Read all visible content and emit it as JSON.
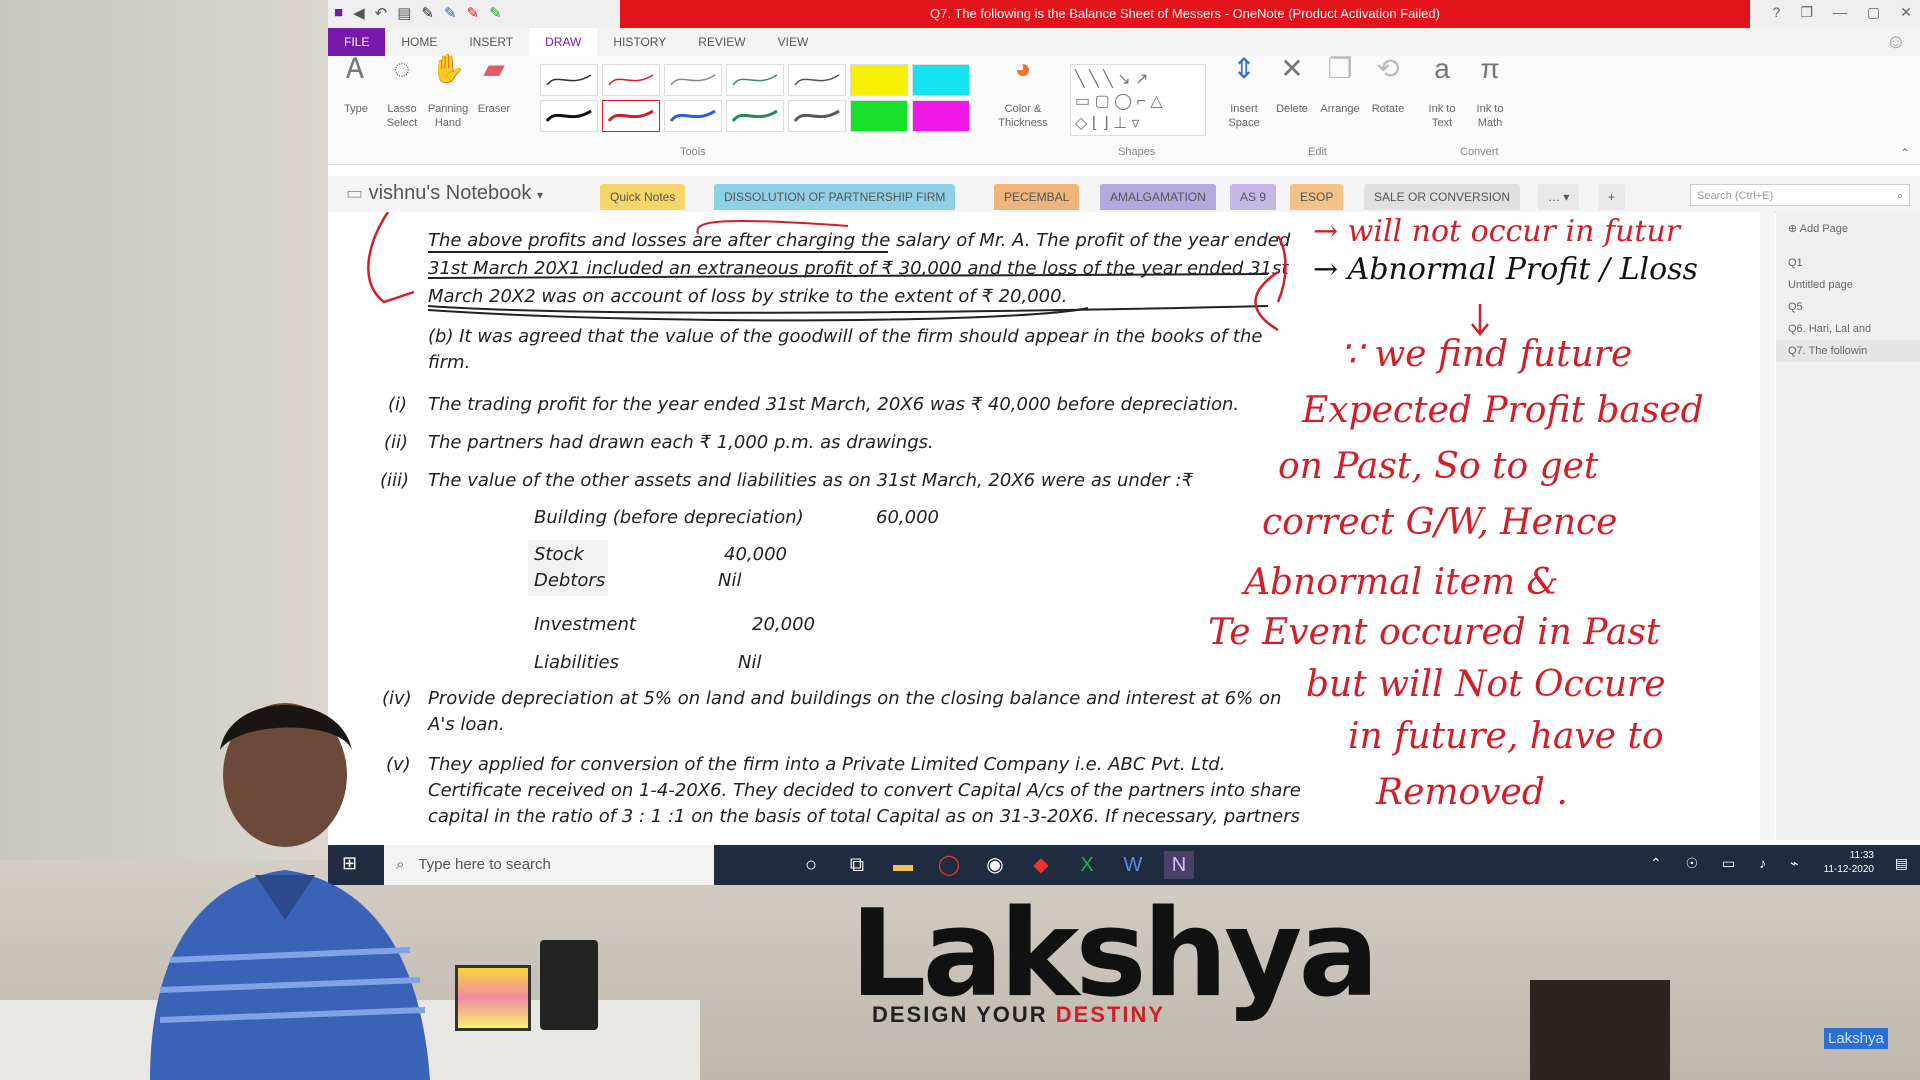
{
  "window": {
    "title": "Q7. The following is the Balance Sheet of Messers - OneNote (Product Activation Failed)",
    "title_color": "#e3131b"
  },
  "ribbon_tabs": [
    "FILE",
    "HOME",
    "INSERT",
    "DRAW",
    "HISTORY",
    "REVIEW",
    "VIEW"
  ],
  "ribbon": {
    "tools": [
      {
        "label": "Type",
        "icon": "type-icon"
      },
      {
        "label": "Lasso Select",
        "icon": "lasso-icon"
      },
      {
        "label": "Panning Hand",
        "icon": "hand-icon"
      },
      {
        "label": "Eraser",
        "icon": "eraser-icon"
      }
    ],
    "tools_group": "Tools",
    "color_thickness": "Color & Thickness",
    "shapes_group": "Shapes",
    "edit_tools": [
      {
        "label": "Insert Space",
        "icon": "insert-space-icon"
      },
      {
        "label": "Delete",
        "icon": "delete-icon"
      },
      {
        "label": "Arrange",
        "icon": "arrange-icon"
      },
      {
        "label": "Rotate",
        "icon": "rotate-icon"
      }
    ],
    "edit_group": "Edit",
    "convert_tools": [
      {
        "label": "Ink to Text",
        "icon": "ink-to-text-icon"
      },
      {
        "label": "Ink to Math",
        "icon": "ink-to-math-icon"
      }
    ],
    "convert_group": "Convert"
  },
  "notebook": {
    "name": "vishnu's Notebook",
    "sections": [
      {
        "label": "Quick Notes",
        "color": "#f6d66b"
      },
      {
        "label": "DISSOLUTION OF PARTNERSHIP FIRM",
        "color": "#8fd0e6"
      },
      {
        "label": "PECEMBAL",
        "color": "#f0b57a"
      },
      {
        "label": "AMALGAMATION",
        "color": "#b4a8de"
      },
      {
        "label": "AS 9",
        "color": "#c6b8e6"
      },
      {
        "label": "ESOP",
        "color": "#f3c18a"
      },
      {
        "label": "SALE OR CONVERSION",
        "color": "#e0e0e0"
      }
    ],
    "search_placeholder": "Search (Ctrl+E)"
  },
  "page_content": {
    "para1_line1": "The above profits and losses are after charging the salary of Mr. A. The profit of the year ended",
    "para1_line2": "31st March 20X1 included an extraneous profit of ₹ 30,000 and the loss of the year ended 31st",
    "para1_line3": "March 20X2 was on account of loss by strike to the extent of ₹ 20,000.",
    "b_line1": "(b)   It was agreed that the value of the goodwill of the firm should appear in   the books of the",
    "b_line2": "firm.",
    "i_num": "(i)",
    "i_text": "The trading profit for the year ended 31st March, 20X6 was ₹ 40,000 before depreciation.",
    "ii_num": "(ii)",
    "ii_text": "The partners had drawn each ₹ 1,000 p.m. as drawings.",
    "iii_num": "(iii)",
    "iii_text": "The value of the other assets and liabilities as on 31st March, 20X6 were as  under :₹",
    "assets": [
      {
        "name": "Building (before depreciation)",
        "value": "60,000"
      },
      {
        "name": "Stock",
        "value": "40,000"
      },
      {
        "name": "Debtors",
        "value": "Nil"
      },
      {
        "name": "Investment",
        "value": "20,000"
      },
      {
        "name": "Liabilities",
        "value": "Nil"
      }
    ],
    "iv_num": "(iv)",
    "iv_line1": "Provide depreciation at 5% on land and buildings on the closing balance and interest at 6% on",
    "iv_line2": "A's loan.",
    "v_num": "(v)",
    "v_line1": "They applied for conversion of the firm into a Private Limited Company i.e. ABC Pvt. Ltd.",
    "v_line2": "Certificate received on 1-4-20X6. They decided to convert Capital A/cs of the partners into share",
    "v_line3": "capital in the ratio of 3 : 1 :1 on the basis of total Capital as on 31-3-20X6. If necessary, partners"
  },
  "handwriting": {
    "ink_color": "#d11f2a",
    "line1": "→ will not occur in futur",
    "line2": "→ Abnormal Profit / Lloss",
    "lines": [
      "∵ we find future",
      "Expected Profit based",
      "on Past, So to get",
      "correct G/W, Hence",
      "Abnormal item &",
      "Te Event occured in Past",
      "but will Not Occure",
      "in future, have to",
      "Removed ."
    ]
  },
  "pages_pane": {
    "add_page": "Add Page",
    "items": [
      "Q1",
      "Untitled page",
      "Q5",
      "Q6. Hari, Lal and",
      "Q7. The followin"
    ],
    "selected_index": 4
  },
  "taskbar": {
    "search_placeholder": "Type here to search",
    "time": "11:33",
    "date": "11-12-2020"
  },
  "branding": {
    "logo": "Lakshya",
    "tagline_part1": "DESIGN YOUR ",
    "tagline_part2": "DESTINY",
    "watermark": "Lakshya"
  }
}
